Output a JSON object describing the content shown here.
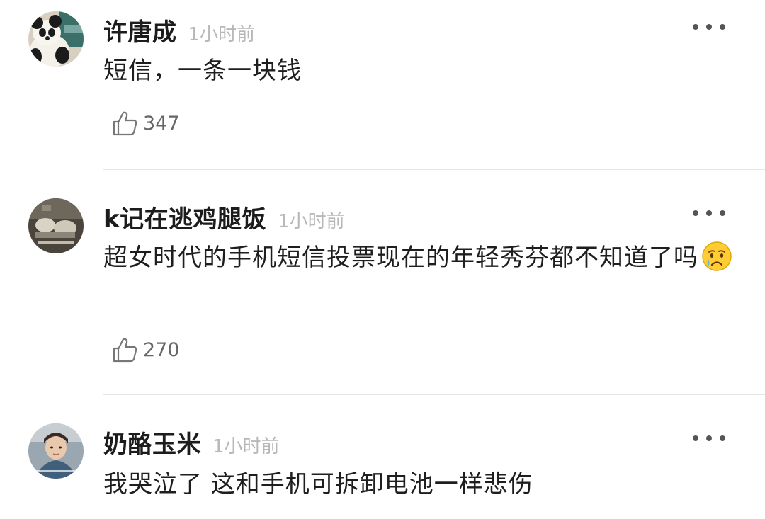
{
  "comments": [
    {
      "username": "许唐成",
      "time": "1小时前",
      "text": "短信，一条一块钱",
      "likes": "347",
      "avatar_icon": "panda-avatar"
    },
    {
      "username": "k记在逃鸡腿饭",
      "time": "1小时前",
      "text": "超女时代的手机短信投票现在的年轻秀芬都不知道了吗",
      "emoji": "crying-face-emoji",
      "likes": "270",
      "avatar_icon": "photo-avatar"
    },
    {
      "username": "奶酪玉米",
      "time": "1小时前",
      "text": "我哭泣了 这和手机可拆卸电池一样悲伤",
      "avatar_icon": "person-avatar"
    }
  ],
  "icons": {
    "more": "more-dots-icon",
    "like": "thumbs-up-icon"
  },
  "colors": {
    "username": "#1c1c1c",
    "timestamp": "#b8b8b8",
    "like_count": "#666666",
    "divider": "#e6e6e6"
  }
}
